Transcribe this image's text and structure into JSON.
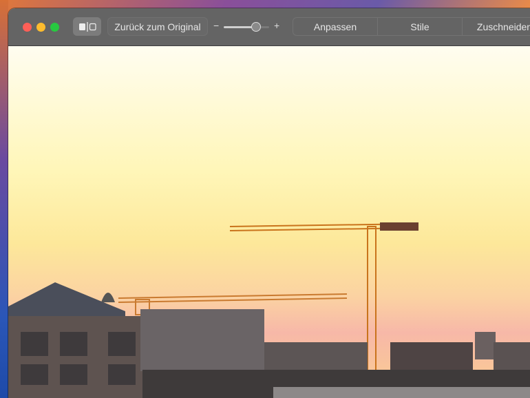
{
  "toolbar": {
    "compare_icon": "split-compare-icon",
    "revert_label": "Zurück zum Original",
    "zoom_minus": "−",
    "zoom_plus": "+",
    "zoom_level": 0.7,
    "tabs": [
      {
        "label": "Anpassen"
      },
      {
        "label": "Stile"
      },
      {
        "label": "Zuschneiden"
      }
    ]
  },
  "colors": {
    "close": "#ff5f57",
    "minimize": "#febc2e",
    "zoom": "#28c840",
    "toolbar": "#646464"
  }
}
